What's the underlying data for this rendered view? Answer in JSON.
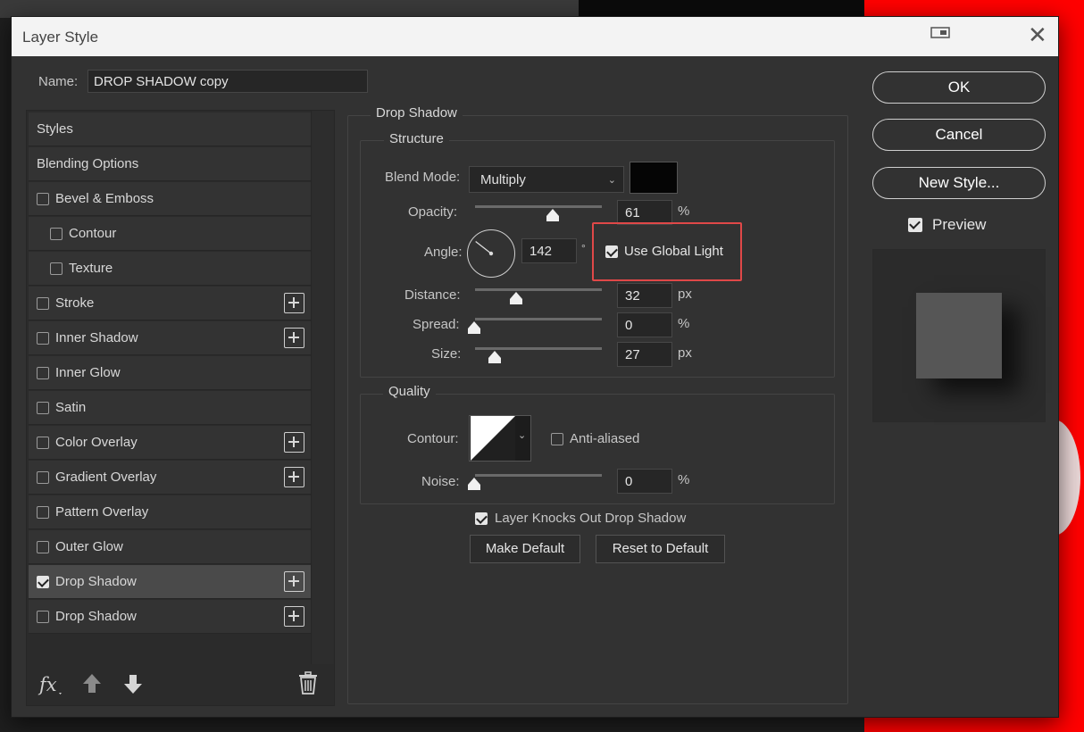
{
  "window": {
    "title": "Layer Style"
  },
  "name_field": {
    "label": "Name:",
    "value": "DROP SHADOW copy"
  },
  "styles_list": {
    "items": [
      {
        "label": "Styles",
        "has_checkbox": false,
        "checked": false,
        "has_plus": false,
        "selected": false,
        "indent": 0
      },
      {
        "label": "Blending Options",
        "has_checkbox": false,
        "checked": false,
        "has_plus": false,
        "selected": false,
        "indent": 0
      },
      {
        "label": "Bevel & Emboss",
        "has_checkbox": true,
        "checked": false,
        "has_plus": false,
        "selected": false,
        "indent": 0
      },
      {
        "label": "Contour",
        "has_checkbox": true,
        "checked": false,
        "has_plus": false,
        "selected": false,
        "indent": 1
      },
      {
        "label": "Texture",
        "has_checkbox": true,
        "checked": false,
        "has_plus": false,
        "selected": false,
        "indent": 1
      },
      {
        "label": "Stroke",
        "has_checkbox": true,
        "checked": false,
        "has_plus": true,
        "selected": false,
        "indent": 0
      },
      {
        "label": "Inner Shadow",
        "has_checkbox": true,
        "checked": false,
        "has_plus": true,
        "selected": false,
        "indent": 0
      },
      {
        "label": "Inner Glow",
        "has_checkbox": true,
        "checked": false,
        "has_plus": false,
        "selected": false,
        "indent": 0
      },
      {
        "label": "Satin",
        "has_checkbox": true,
        "checked": false,
        "has_plus": false,
        "selected": false,
        "indent": 0
      },
      {
        "label": "Color Overlay",
        "has_checkbox": true,
        "checked": false,
        "has_plus": true,
        "selected": false,
        "indent": 0
      },
      {
        "label": "Gradient Overlay",
        "has_checkbox": true,
        "checked": false,
        "has_plus": true,
        "selected": false,
        "indent": 0
      },
      {
        "label": "Pattern Overlay",
        "has_checkbox": true,
        "checked": false,
        "has_plus": false,
        "selected": false,
        "indent": 0
      },
      {
        "label": "Outer Glow",
        "has_checkbox": true,
        "checked": false,
        "has_plus": false,
        "selected": false,
        "indent": 0
      },
      {
        "label": "Drop Shadow",
        "has_checkbox": true,
        "checked": true,
        "has_plus": true,
        "selected": true,
        "indent": 0
      },
      {
        "label": "Drop Shadow",
        "has_checkbox": true,
        "checked": false,
        "has_plus": true,
        "selected": false,
        "indent": 0
      }
    ],
    "bottom_icons": [
      "fx-icon",
      "move-up-icon",
      "move-down-icon",
      "trash-icon"
    ]
  },
  "drop_shadow": {
    "section_title": "Drop Shadow",
    "structure": {
      "title": "Structure",
      "blend_mode_label": "Blend Mode:",
      "blend_mode": "Multiply",
      "shadow_color": "#050505",
      "opacity_label": "Opacity:",
      "opacity": "61",
      "opacity_unit": "%",
      "opacity_level": 0.61,
      "angle_label": "Angle:",
      "angle": "142",
      "angle_unit": "°",
      "use_global_light_label": "Use Global Light",
      "use_global_light": true,
      "distance_label": "Distance:",
      "distance": "32",
      "distance_unit": "px",
      "spread_label": "Spread:",
      "spread": "0",
      "spread_unit": "%",
      "size_label": "Size:",
      "size": "27",
      "size_unit": "px"
    },
    "quality": {
      "title": "Quality",
      "contour_label": "Contour:",
      "anti_aliased_label": "Anti-aliased",
      "anti_aliased": false,
      "noise_label": "Noise:",
      "noise": "0",
      "noise_unit": "%"
    },
    "knocks_out_label": "Layer Knocks Out Drop Shadow",
    "knocks_out": true,
    "make_default_label": "Make Default",
    "reset_default_label": "Reset to Default"
  },
  "right_panel": {
    "ok_label": "OK",
    "cancel_label": "Cancel",
    "new_style_label": "New Style...",
    "preview_label": "Preview",
    "preview_checked": true
  },
  "colors": {
    "highlight": "#e04848",
    "accent_red": "#ff0000"
  }
}
